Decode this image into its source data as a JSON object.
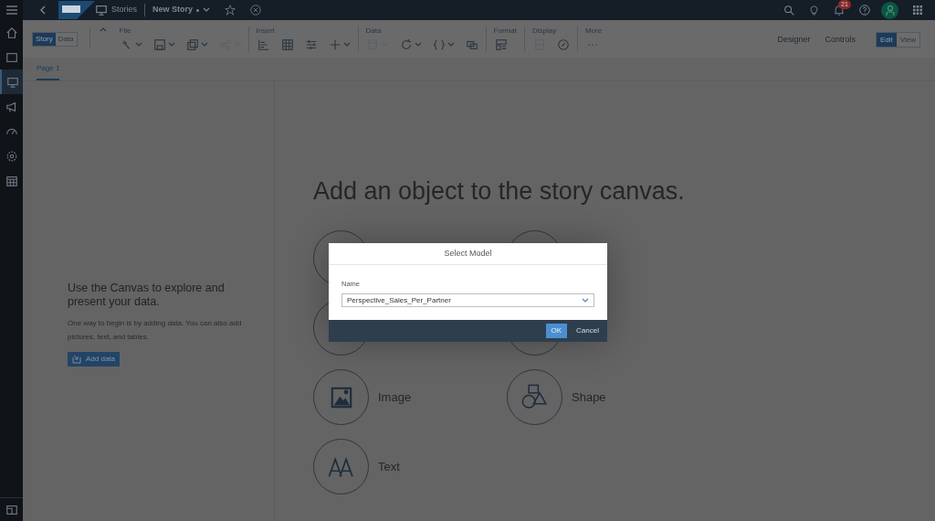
{
  "shell": {
    "breadcrumb": "Stories",
    "story_title": "New Story",
    "story_modified": true,
    "notification_count": "21"
  },
  "nav_items": [
    {
      "selected": false
    },
    {
      "selected": false
    },
    {
      "selected": true
    },
    {
      "selected": false
    },
    {
      "selected": false
    },
    {
      "selected": false
    },
    {
      "selected": false
    }
  ],
  "mode_tabs": [
    {
      "label": "Story",
      "selected": true
    },
    {
      "label": "Data",
      "selected": false
    }
  ],
  "toolbar_groups": [
    {
      "label": "File",
      "tools": [
        {
          "caret": true,
          "disabled": false
        },
        {
          "caret": true,
          "disabled": false
        },
        {
          "caret": true,
          "disabled": false
        },
        {
          "caret": true,
          "disabled": true
        }
      ]
    },
    {
      "label": "Insert",
      "tools": [
        {
          "caret": false,
          "disabled": false
        },
        {
          "caret": false,
          "disabled": false
        },
        {
          "caret": false,
          "disabled": false
        },
        {
          "caret": true,
          "disabled": false
        }
      ]
    },
    {
      "label": "Data",
      "tools": [
        {
          "caret": true,
          "disabled": true
        },
        {
          "caret": true,
          "disabled": false
        },
        {
          "caret": true,
          "disabled": false
        },
        {
          "caret": false,
          "disabled": false
        }
      ]
    },
    {
      "label": "Format",
      "tools": [
        {
          "caret": false,
          "disabled": false
        }
      ]
    },
    {
      "label": "Display",
      "tools": [
        {
          "caret": false,
          "disabled": true
        },
        {
          "caret": false,
          "disabled": false
        }
      ]
    },
    {
      "label": "More",
      "tools": [
        {
          "caret": false,
          "disabled": false
        }
      ]
    }
  ],
  "side_tabs": [
    "Designer",
    "Controls"
  ],
  "view_tabs": [
    {
      "label": "Edit",
      "selected": true
    },
    {
      "label": "View",
      "selected": false
    }
  ],
  "page_tabs": [
    {
      "label": "Page 1",
      "selected": true
    }
  ],
  "intro": {
    "heading": "Use the Canvas to explore and present your data.",
    "body": "One way to begin is by adding data. You can also add pictures, text, and tables.",
    "button": "Add data"
  },
  "canvas": {
    "heading": "Add an object to the story canvas.",
    "objects": [
      {
        "label": "Image"
      },
      {
        "label": "Shape"
      },
      {
        "label": "Text"
      }
    ]
  },
  "dialog": {
    "title": "Select Model",
    "field_label": "Name",
    "value": "Perspective_Sales_Per_Partner",
    "buttons": [
      {
        "label": "OK",
        "kind": "primary"
      },
      {
        "label": "Cancel",
        "kind": "plain"
      }
    ]
  }
}
